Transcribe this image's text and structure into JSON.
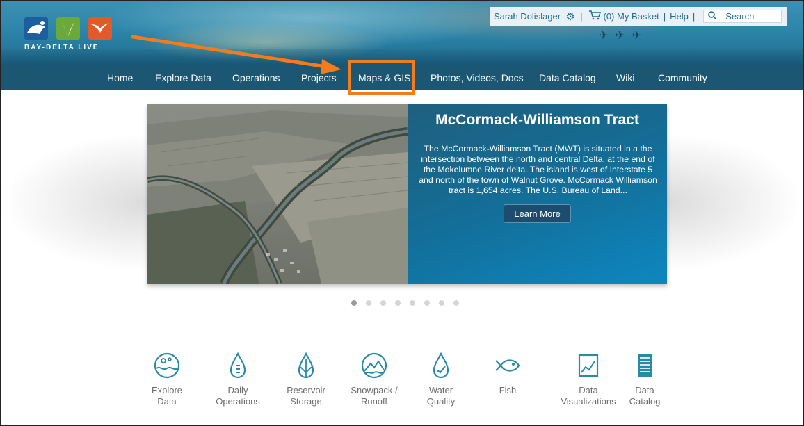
{
  "header": {
    "brand": "BAY-DELTA LIVE",
    "user_name": "Sarah Dolislager",
    "basket": "(0) My Basket",
    "help": "Help",
    "search_placeholder": "Search"
  },
  "nav": {
    "items": [
      "Home",
      "Explore Data",
      "Operations",
      "Projects",
      "Maps & GIS",
      "Photos, Videos, Docs",
      "Data Catalog",
      "Wiki",
      "Community"
    ]
  },
  "carousel": {
    "title": "McCormack-Williamson Tract",
    "description": "The McCormack-Williamson Tract (MWT) is situated in a the intersection between the north and central Delta, at the end of the Mokelumne River delta. The island is west of Interstate 5 and north of the town of Walnut Grove. McCormack Williamson tract is 1,654 acres. The U.S. Bureau of Land...",
    "button": "Learn More",
    "slide_count": 8,
    "active_slide": 1
  },
  "quick_links": [
    {
      "line1": "Explore",
      "line2": "Data",
      "icon": "globe-water-icon"
    },
    {
      "line1": "Daily",
      "line2": "Operations",
      "icon": "water-drop-meter-icon"
    },
    {
      "line1": "Reservoir",
      "line2": "Storage",
      "icon": "reservoir-drop-icon"
    },
    {
      "line1": "Snowpack /",
      "line2": "Runoff",
      "icon": "mountain-icon"
    },
    {
      "line1": "Water",
      "line2": "Quality",
      "icon": "drop-check-icon"
    },
    {
      "line1": "Fish",
      "line2": "",
      "icon": "fish-icon"
    },
    {
      "line1": "Data",
      "line2": "Visualizations",
      "icon": "chart-icon"
    },
    {
      "line1": "Data",
      "line2": "Catalog",
      "icon": "catalog-icon"
    }
  ],
  "colors": {
    "nav_bg": "#1b5673",
    "highlight": "#f07c1d",
    "panel_bg": "#136e98",
    "icon": "#2a8aa6"
  }
}
